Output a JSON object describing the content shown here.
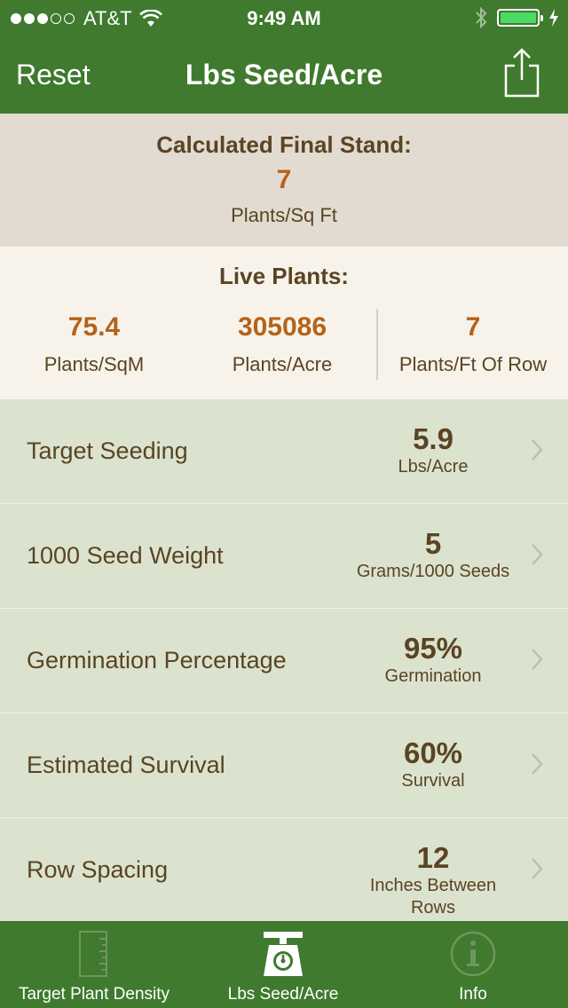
{
  "status": {
    "carrier": "AT&T",
    "time": "9:49 AM"
  },
  "nav": {
    "reset": "Reset",
    "title": "Lbs Seed/Acre"
  },
  "final_stand": {
    "title": "Calculated Final Stand:",
    "value": "7",
    "unit": "Plants/Sq Ft"
  },
  "live": {
    "title": "Live Plants:",
    "items": [
      {
        "value": "75.4",
        "unit": "Plants/SqM"
      },
      {
        "value": "305086",
        "unit": "Plants/Acre"
      },
      {
        "value": "7",
        "unit": "Plants/Ft Of Row"
      }
    ]
  },
  "rows": [
    {
      "label": "Target Seeding",
      "value": "5.9",
      "unit": "Lbs/Acre"
    },
    {
      "label": "1000 Seed Weight",
      "value": "5",
      "unit": "Grams/1000 Seeds"
    },
    {
      "label": "Germination Percentage",
      "value": "95%",
      "unit": "Germination"
    },
    {
      "label": "Estimated Survival",
      "value": "60%",
      "unit": "Survival"
    },
    {
      "label": "Row Spacing",
      "value": "12",
      "unit": "Inches Between Rows"
    }
  ],
  "tabs": [
    {
      "label": "Target Plant Density",
      "icon": "ruler-icon"
    },
    {
      "label": "Lbs Seed/Acre",
      "icon": "scale-icon",
      "active": true
    },
    {
      "label": "Info",
      "icon": "info-icon"
    }
  ],
  "colors": {
    "brand_green": "#3f7a2f",
    "accent_orange": "#b5621b",
    "text_brown": "#5a4423",
    "row_bg": "#dbe3cf"
  }
}
